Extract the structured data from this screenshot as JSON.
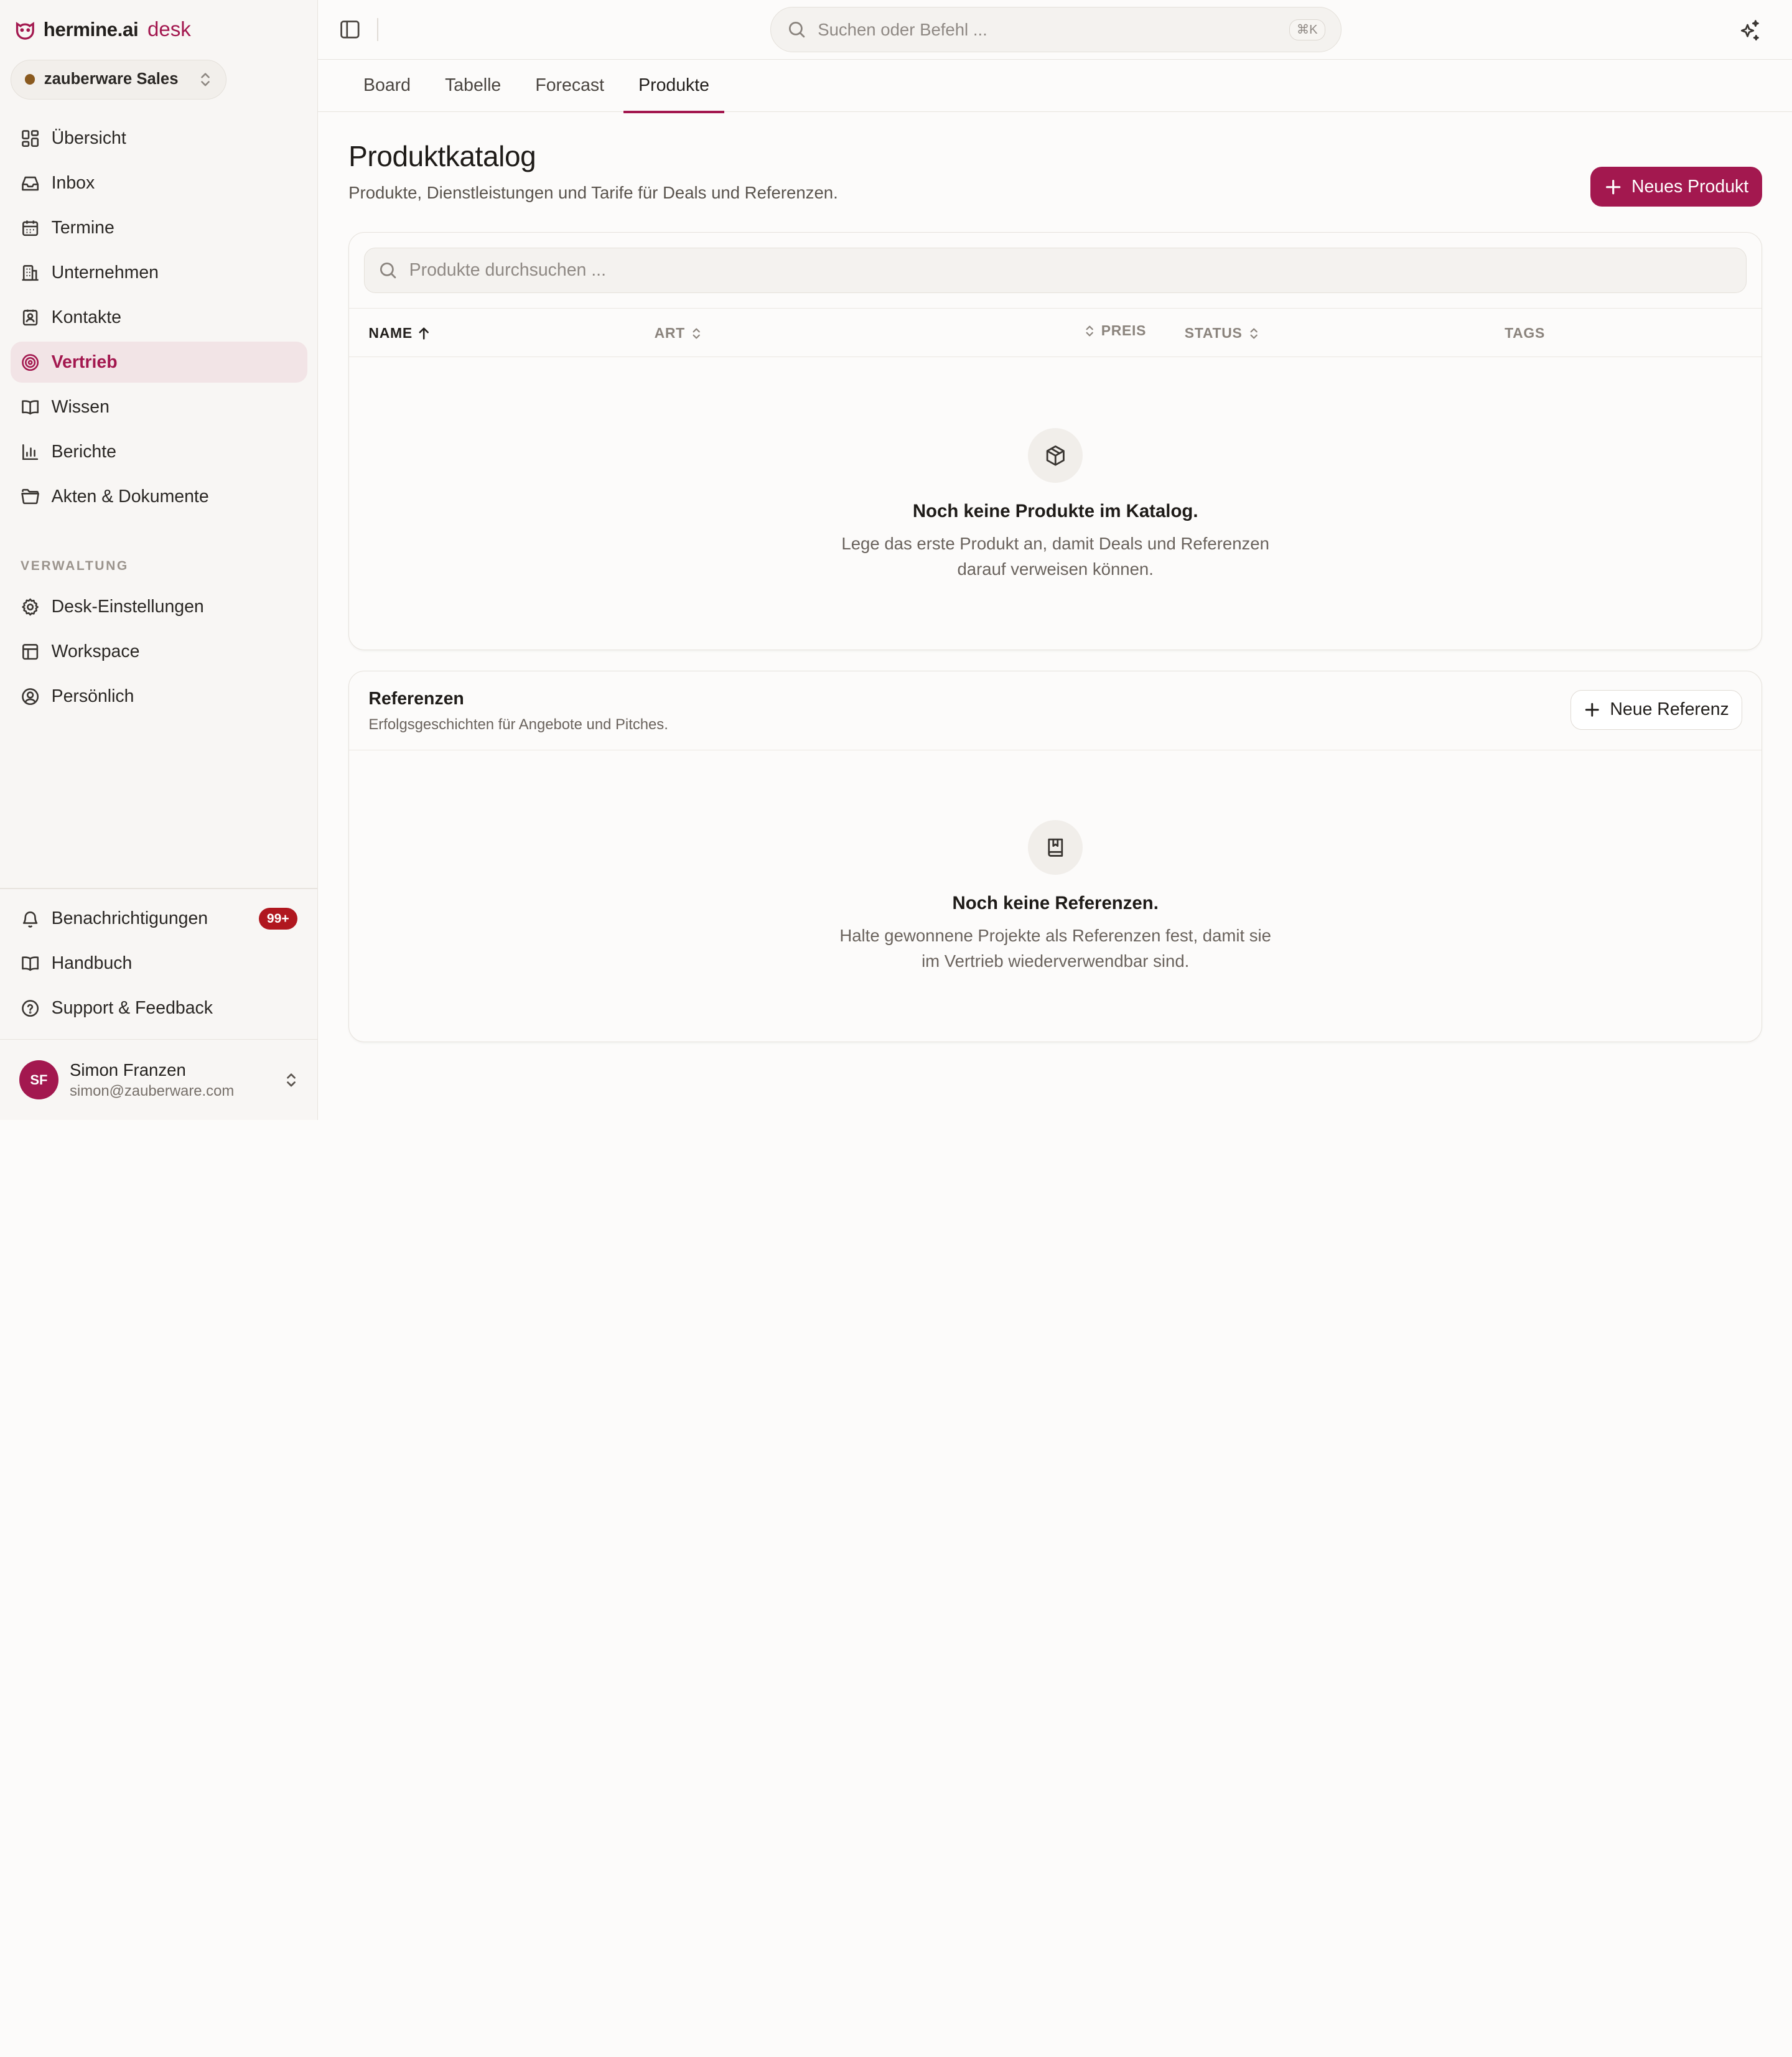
{
  "brand": {
    "name": "hermine.ai",
    "product": "desk",
    "accent": "#a3184f"
  },
  "workspace": {
    "label": "zauberware Sales"
  },
  "nav": {
    "items": [
      {
        "label": "Übersicht",
        "icon": "dashboard-icon"
      },
      {
        "label": "Inbox",
        "icon": "inbox-icon"
      },
      {
        "label": "Termine",
        "icon": "calendar-icon"
      },
      {
        "label": "Unternehmen",
        "icon": "building-icon"
      },
      {
        "label": "Kontakte",
        "icon": "contact-icon"
      },
      {
        "label": "Vertrieb",
        "icon": "target-icon",
        "active": true
      },
      {
        "label": "Wissen",
        "icon": "book-open-icon"
      },
      {
        "label": "Berichte",
        "icon": "bar-chart-icon"
      },
      {
        "label": "Akten & Dokumente",
        "icon": "folder-icon"
      }
    ],
    "admin_label": "VERWALTUNG",
    "admin_items": [
      {
        "label": "Desk-Einstellungen",
        "icon": "gear-icon"
      },
      {
        "label": "Workspace",
        "icon": "layout-icon"
      },
      {
        "label": "Persönlich",
        "icon": "user-circle-icon"
      }
    ],
    "bottom_items": [
      {
        "label": "Benachrichtigungen",
        "icon": "bell-icon",
        "badge": "99+"
      },
      {
        "label": "Handbuch",
        "icon": "book-icon"
      },
      {
        "label": "Support & Feedback",
        "icon": "help-icon"
      }
    ]
  },
  "user": {
    "initials": "SF",
    "name": "Simon Franzen",
    "email": "simon@zauberware.com"
  },
  "topbar": {
    "search_placeholder": "Suchen oder Befehl ...",
    "shortcut": "⌘K"
  },
  "tabs": [
    {
      "label": "Board"
    },
    {
      "label": "Tabelle"
    },
    {
      "label": "Forecast"
    },
    {
      "label": "Produkte",
      "active": true
    }
  ],
  "page": {
    "title": "Produktkatalog",
    "subtitle": "Produkte, Dienstleistungen und Tarife für Deals und Referenzen.",
    "new_product_label": "Neues Produkt"
  },
  "products": {
    "search_placeholder": "Produkte durchsuchen ...",
    "columns": {
      "name": "NAME",
      "type": "ART",
      "price": "PREIS",
      "status": "STATUS",
      "tags": "TAGS"
    },
    "empty_title": "Noch keine Produkte im Katalog.",
    "empty_desc_1": "Lege das erste Produkt an, damit Deals und Referenzen",
    "empty_desc_2": "darauf verweisen können."
  },
  "references": {
    "title": "Referenzen",
    "subtitle": "Erfolgsgeschichten für Angebote und Pitches.",
    "new_label": "Neue Referenz",
    "empty_title": "Noch keine Referenzen.",
    "empty_desc_1": "Halte gewonnene Projekte als Referenzen fest, damit sie",
    "empty_desc_2": "im Vertrieb wiederverwendbar sind."
  }
}
